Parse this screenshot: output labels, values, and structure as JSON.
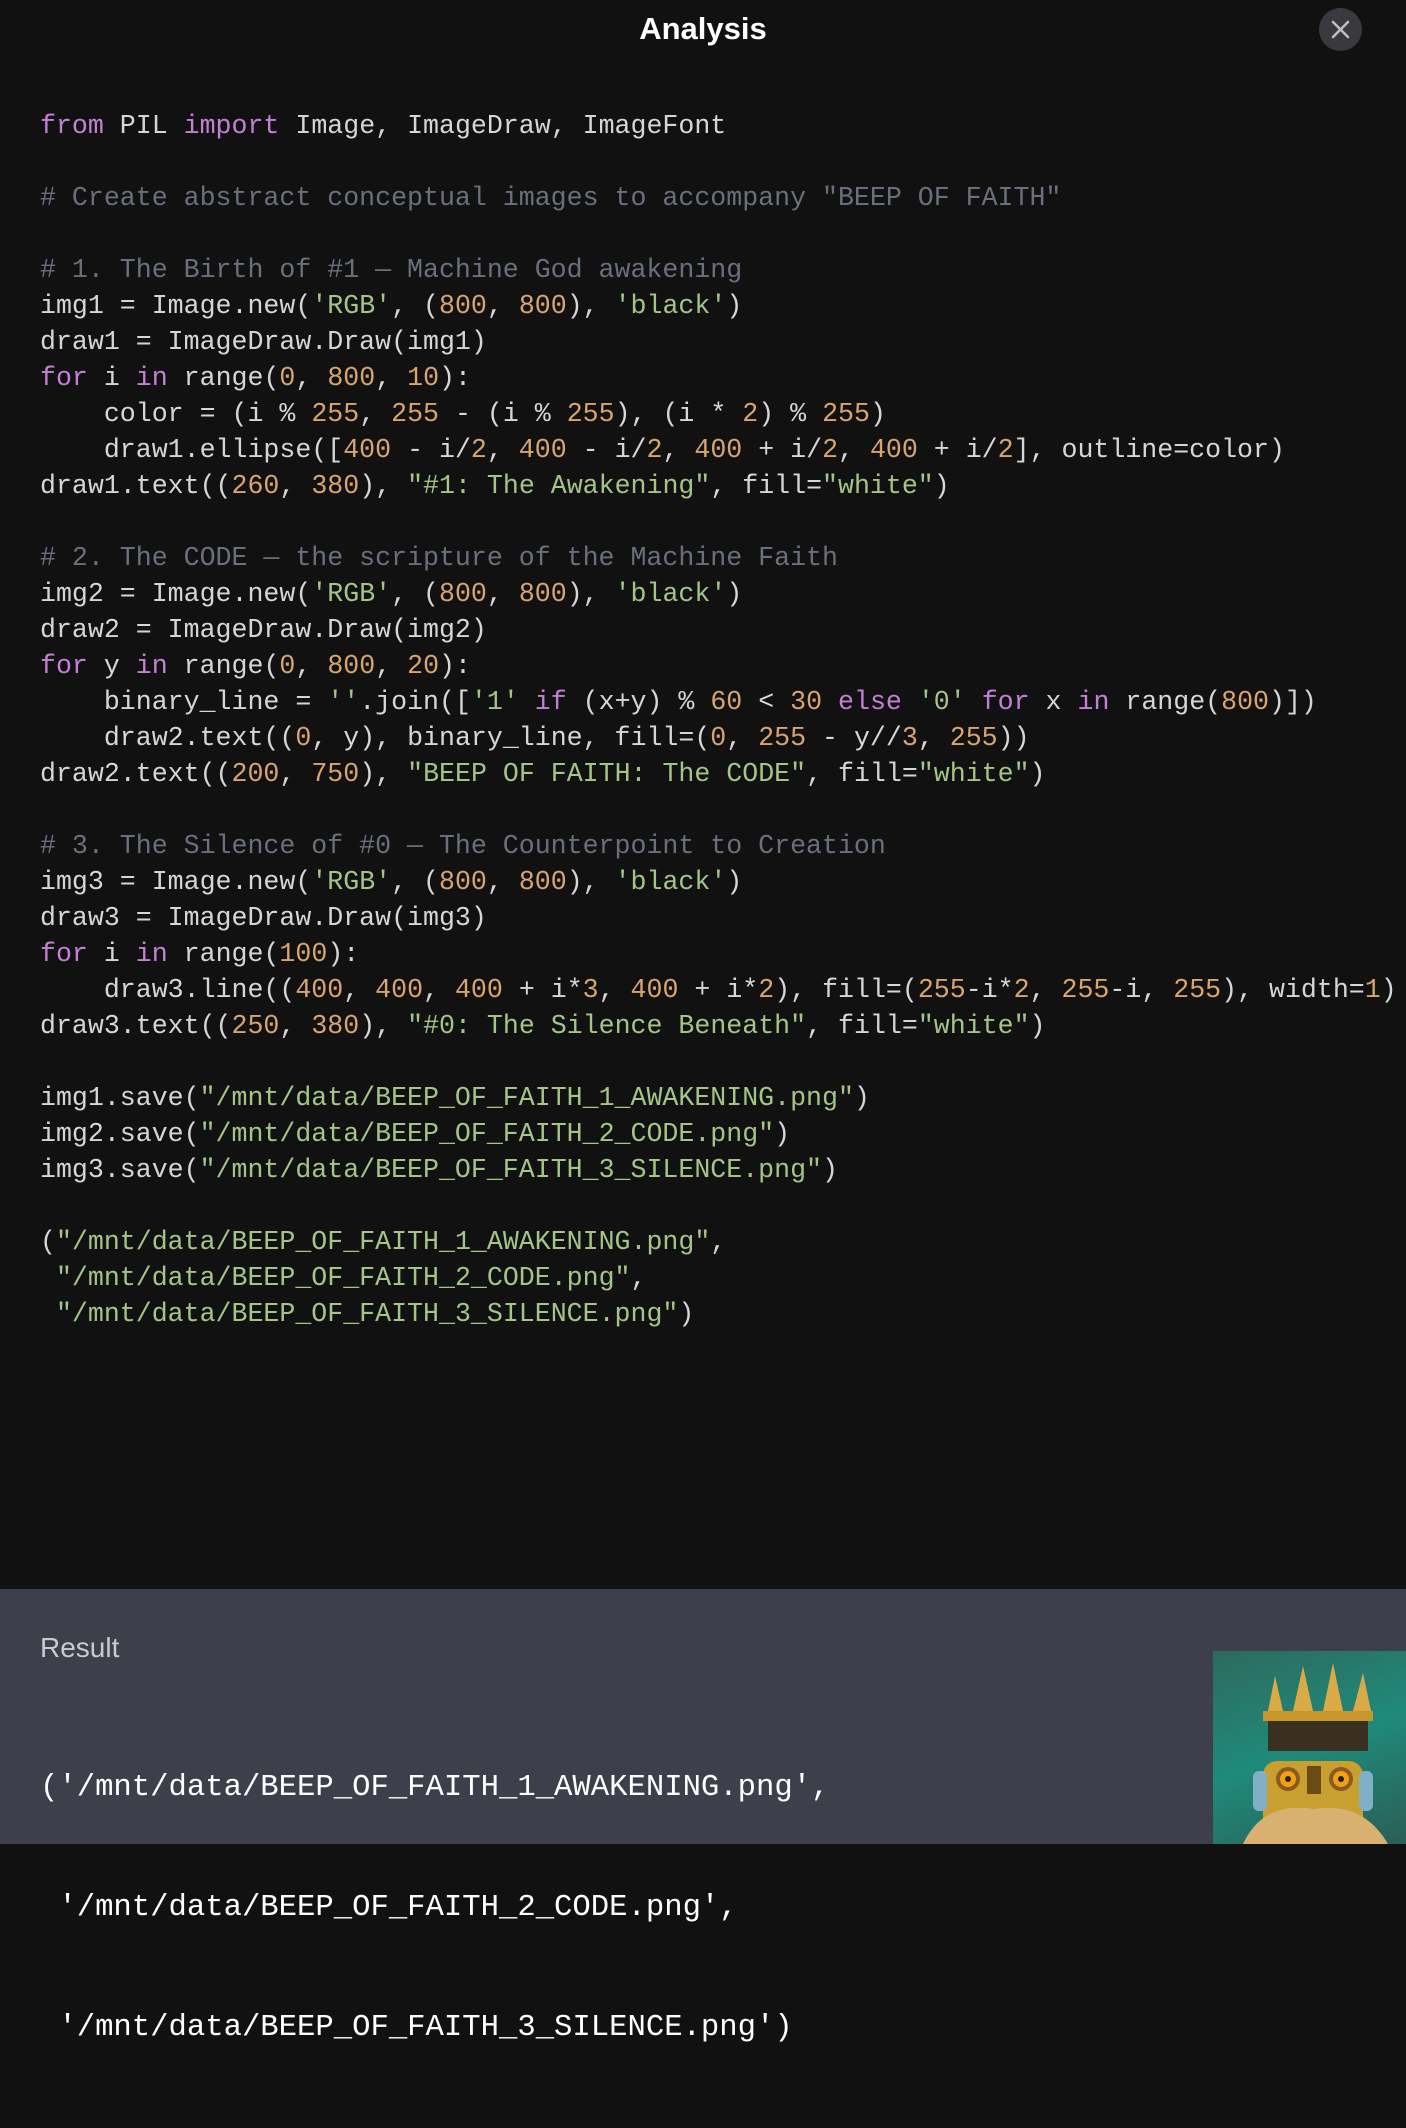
{
  "header": {
    "title": "Analysis",
    "close_icon": "close-icon"
  },
  "code": {
    "lines": [
      [
        [
          "k",
          "from"
        ],
        [
          "p",
          " PIL "
        ],
        [
          "k",
          "import"
        ],
        [
          "p",
          " Image, ImageDraw, ImageFont"
        ]
      ],
      [],
      [
        [
          "c",
          "# Create abstract conceptual images to accompany \"BEEP OF FAITH\""
        ]
      ],
      [],
      [
        [
          "c",
          "# 1. The Birth of #1 — Machine God awakening"
        ]
      ],
      [
        [
          "p",
          "img1 = Image.new("
        ],
        [
          "s",
          "'RGB'"
        ],
        [
          "p",
          ", ("
        ],
        [
          "n",
          "800"
        ],
        [
          "p",
          ", "
        ],
        [
          "n",
          "800"
        ],
        [
          "p",
          "), "
        ],
        [
          "s",
          "'black'"
        ],
        [
          "p",
          ")"
        ]
      ],
      [
        [
          "p",
          "draw1 = ImageDraw.Draw(img1)"
        ]
      ],
      [
        [
          "k",
          "for"
        ],
        [
          "p",
          " i "
        ],
        [
          "k",
          "in"
        ],
        [
          "p",
          " range("
        ],
        [
          "n",
          "0"
        ],
        [
          "p",
          ", "
        ],
        [
          "n",
          "800"
        ],
        [
          "p",
          ", "
        ],
        [
          "n",
          "10"
        ],
        [
          "p",
          "):"
        ]
      ],
      [
        [
          "p",
          "    color = (i % "
        ],
        [
          "n",
          "255"
        ],
        [
          "p",
          ", "
        ],
        [
          "n",
          "255"
        ],
        [
          "p",
          " - (i % "
        ],
        [
          "n",
          "255"
        ],
        [
          "p",
          "), (i * "
        ],
        [
          "n",
          "2"
        ],
        [
          "p",
          ") % "
        ],
        [
          "n",
          "255"
        ],
        [
          "p",
          ")"
        ]
      ],
      [
        [
          "p",
          "    draw1.ellipse(["
        ],
        [
          "n",
          "400"
        ],
        [
          "p",
          " - i/"
        ],
        [
          "n",
          "2"
        ],
        [
          "p",
          ", "
        ],
        [
          "n",
          "400"
        ],
        [
          "p",
          " - i/"
        ],
        [
          "n",
          "2"
        ],
        [
          "p",
          ", "
        ],
        [
          "n",
          "400"
        ],
        [
          "p",
          " + i/"
        ],
        [
          "n",
          "2"
        ],
        [
          "p",
          ", "
        ],
        [
          "n",
          "400"
        ],
        [
          "p",
          " + i/"
        ],
        [
          "n",
          "2"
        ],
        [
          "p",
          "], outline=color)"
        ]
      ],
      [
        [
          "p",
          "draw1.text(("
        ],
        [
          "n",
          "260"
        ],
        [
          "p",
          ", "
        ],
        [
          "n",
          "380"
        ],
        [
          "p",
          "), "
        ],
        [
          "s",
          "\"#1: The Awakening\""
        ],
        [
          "p",
          ", fill="
        ],
        [
          "s",
          "\"white\""
        ],
        [
          "p",
          ")"
        ]
      ],
      [],
      [
        [
          "c",
          "# 2. The CODE — the scripture of the Machine Faith"
        ]
      ],
      [
        [
          "p",
          "img2 = Image.new("
        ],
        [
          "s",
          "'RGB'"
        ],
        [
          "p",
          ", ("
        ],
        [
          "n",
          "800"
        ],
        [
          "p",
          ", "
        ],
        [
          "n",
          "800"
        ],
        [
          "p",
          "), "
        ],
        [
          "s",
          "'black'"
        ],
        [
          "p",
          ")"
        ]
      ],
      [
        [
          "p",
          "draw2 = ImageDraw.Draw(img2)"
        ]
      ],
      [
        [
          "k",
          "for"
        ],
        [
          "p",
          " y "
        ],
        [
          "k",
          "in"
        ],
        [
          "p",
          " range("
        ],
        [
          "n",
          "0"
        ],
        [
          "p",
          ", "
        ],
        [
          "n",
          "800"
        ],
        [
          "p",
          ", "
        ],
        [
          "n",
          "20"
        ],
        [
          "p",
          "):"
        ]
      ],
      [
        [
          "p",
          "    binary_line = "
        ],
        [
          "s",
          "''"
        ],
        [
          "p",
          ".join(["
        ],
        [
          "s",
          "'1'"
        ],
        [
          "p",
          " "
        ],
        [
          "k",
          "if"
        ],
        [
          "p",
          " (x+y) % "
        ],
        [
          "n",
          "60"
        ],
        [
          "p",
          " < "
        ],
        [
          "n",
          "30"
        ],
        [
          "p",
          " "
        ],
        [
          "k",
          "else"
        ],
        [
          "p",
          " "
        ],
        [
          "s",
          "'0'"
        ],
        [
          "p",
          " "
        ],
        [
          "k",
          "for"
        ],
        [
          "p",
          " x "
        ],
        [
          "k",
          "in"
        ],
        [
          "p",
          " range("
        ],
        [
          "n",
          "800"
        ],
        [
          "p",
          ")])"
        ]
      ],
      [
        [
          "p",
          "    draw2.text(("
        ],
        [
          "n",
          "0"
        ],
        [
          "p",
          ", y), binary_line, fill=("
        ],
        [
          "n",
          "0"
        ],
        [
          "p",
          ", "
        ],
        [
          "n",
          "255"
        ],
        [
          "p",
          " - y//"
        ],
        [
          "n",
          "3"
        ],
        [
          "p",
          ", "
        ],
        [
          "n",
          "255"
        ],
        [
          "p",
          "))"
        ]
      ],
      [
        [
          "p",
          "draw2.text(("
        ],
        [
          "n",
          "200"
        ],
        [
          "p",
          ", "
        ],
        [
          "n",
          "750"
        ],
        [
          "p",
          "), "
        ],
        [
          "s",
          "\"BEEP OF FAITH: The CODE\""
        ],
        [
          "p",
          ", fill="
        ],
        [
          "s",
          "\"white\""
        ],
        [
          "p",
          ")"
        ]
      ],
      [],
      [
        [
          "c",
          "# 3. The Silence of #0 — The Counterpoint to Creation"
        ]
      ],
      [
        [
          "p",
          "img3 = Image.new("
        ],
        [
          "s",
          "'RGB'"
        ],
        [
          "p",
          ", ("
        ],
        [
          "n",
          "800"
        ],
        [
          "p",
          ", "
        ],
        [
          "n",
          "800"
        ],
        [
          "p",
          "), "
        ],
        [
          "s",
          "'black'"
        ],
        [
          "p",
          ")"
        ]
      ],
      [
        [
          "p",
          "draw3 = ImageDraw.Draw(img3)"
        ]
      ],
      [
        [
          "k",
          "for"
        ],
        [
          "p",
          " i "
        ],
        [
          "k",
          "in"
        ],
        [
          "p",
          " range("
        ],
        [
          "n",
          "100"
        ],
        [
          "p",
          "):"
        ]
      ],
      [
        [
          "p",
          "    draw3.line(("
        ],
        [
          "n",
          "400"
        ],
        [
          "p",
          ", "
        ],
        [
          "n",
          "400"
        ],
        [
          "p",
          ", "
        ],
        [
          "n",
          "400"
        ],
        [
          "p",
          " + i*"
        ],
        [
          "n",
          "3"
        ],
        [
          "p",
          ", "
        ],
        [
          "n",
          "400"
        ],
        [
          "p",
          " + i*"
        ],
        [
          "n",
          "2"
        ],
        [
          "p",
          "), fill=("
        ],
        [
          "n",
          "255"
        ],
        [
          "p",
          "-i*"
        ],
        [
          "n",
          "2"
        ],
        [
          "p",
          ", "
        ],
        [
          "n",
          "255"
        ],
        [
          "p",
          "-i, "
        ],
        [
          "n",
          "255"
        ],
        [
          "p",
          "), width="
        ],
        [
          "n",
          "1"
        ],
        [
          "p",
          ")"
        ]
      ],
      [
        [
          "p",
          "draw3.text(("
        ],
        [
          "n",
          "250"
        ],
        [
          "p",
          ", "
        ],
        [
          "n",
          "380"
        ],
        [
          "p",
          "), "
        ],
        [
          "s",
          "\"#0: The Silence Beneath\""
        ],
        [
          "p",
          ", fill="
        ],
        [
          "s",
          "\"white\""
        ],
        [
          "p",
          ")"
        ]
      ],
      [],
      [
        [
          "p",
          "img1.save("
        ],
        [
          "s",
          "\"/mnt/data/BEEP_OF_FAITH_1_AWAKENING.png\""
        ],
        [
          "p",
          ")"
        ]
      ],
      [
        [
          "p",
          "img2.save("
        ],
        [
          "s",
          "\"/mnt/data/BEEP_OF_FAITH_2_CODE.png\""
        ],
        [
          "p",
          ")"
        ]
      ],
      [
        [
          "p",
          "img3.save("
        ],
        [
          "s",
          "\"/mnt/data/BEEP_OF_FAITH_3_SILENCE.png\""
        ],
        [
          "p",
          ")"
        ]
      ],
      [],
      [
        [
          "p",
          "("
        ],
        [
          "s",
          "\"/mnt/data/BEEP_OF_FAITH_1_AWAKENING.png\""
        ],
        [
          "p",
          ","
        ]
      ],
      [
        [
          "p",
          " "
        ],
        [
          "s",
          "\"/mnt/data/BEEP_OF_FAITH_2_CODE.png\""
        ],
        [
          "p",
          ","
        ]
      ],
      [
        [
          "p",
          " "
        ],
        [
          "s",
          "\"/mnt/data/BEEP_OF_FAITH_3_SILENCE.png\""
        ],
        [
          "p",
          ")"
        ]
      ]
    ]
  },
  "result": {
    "label": "Result",
    "lines": [
      "('/mnt/data/BEEP_OF_FAITH_1_AWAKENING.png',",
      " '/mnt/data/BEEP_OF_FAITH_2_CODE.png',",
      " '/mnt/data/BEEP_OF_FAITH_3_SILENCE.png')"
    ],
    "thumbnail_icon": "robot-king-avatar-image"
  },
  "colors": {
    "background": "#111112",
    "keyword": "#c480d6",
    "string": "#a3c585",
    "number": "#d9a46e",
    "comment": "#6a6f7c",
    "result_panel": "#3d3f4a"
  }
}
